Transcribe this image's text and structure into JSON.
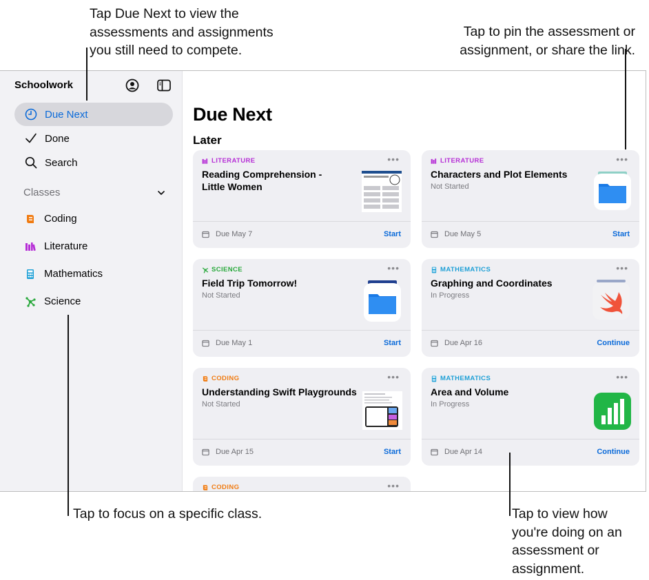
{
  "callouts": {
    "due_next": [
      "Tap Due Next to view the",
      "assessments and assignments",
      "you still need to compete."
    ],
    "pin": [
      "Tap to pin the assessment or",
      "assignment, or share the link."
    ],
    "class": [
      "Tap to focus on a specific class."
    ],
    "progress": [
      "Tap to view how",
      "you're doing on an",
      "assessment or",
      "assignment."
    ]
  },
  "sidebar": {
    "title": "Schoolwork",
    "nav": [
      "Due Next",
      "Done",
      "Search"
    ],
    "classes_label": "Classes",
    "classes": [
      "Coding",
      "Literature",
      "Mathematics",
      "Science"
    ]
  },
  "main": {
    "title": "Due Next",
    "section": "Later",
    "cards": [
      {
        "class": "LITERATURE",
        "title": "Reading Comprehension - Little Women",
        "status": "",
        "due": "Due May 7",
        "action": "Start"
      },
      {
        "class": "LITERATURE",
        "title": "Characters and Plot Elements",
        "status": "Not Started",
        "due": "Due May 5",
        "action": "Start"
      },
      {
        "class": "SCIENCE",
        "title": "Field Trip Tomorrow!",
        "status": "Not Started",
        "due": "Due May 1",
        "action": "Start"
      },
      {
        "class": "MATHEMATICS",
        "title": "Graphing and Coordinates",
        "status": "In Progress",
        "due": "Due Apr 16",
        "action": "Continue"
      },
      {
        "class": "CODING",
        "title": "Understanding Swift Playgrounds",
        "status": "Not Started",
        "due": "Due Apr 15",
        "action": "Start"
      },
      {
        "class": "MATHEMATICS",
        "title": "Area and Volume",
        "status": "In Progress",
        "due": "Due Apr 14",
        "action": "Continue"
      },
      {
        "class": "CODING",
        "title": "",
        "status": "",
        "due": "",
        "action": ""
      }
    ],
    "more_label": "•••"
  },
  "colors": {
    "accent": "#0a6ad9",
    "literature": "#b62fd6",
    "science": "#27a83a",
    "mathematics": "#1c9fd6",
    "coding": "#f07b11"
  },
  "icons": [
    "clock-icon",
    "checkmark-icon",
    "search-icon",
    "chevron-down-icon",
    "profile-icon",
    "sidebar-toggle-icon",
    "files-app-icon",
    "swift-app-icon",
    "numbers-app-icon",
    "calendar-icon"
  ]
}
